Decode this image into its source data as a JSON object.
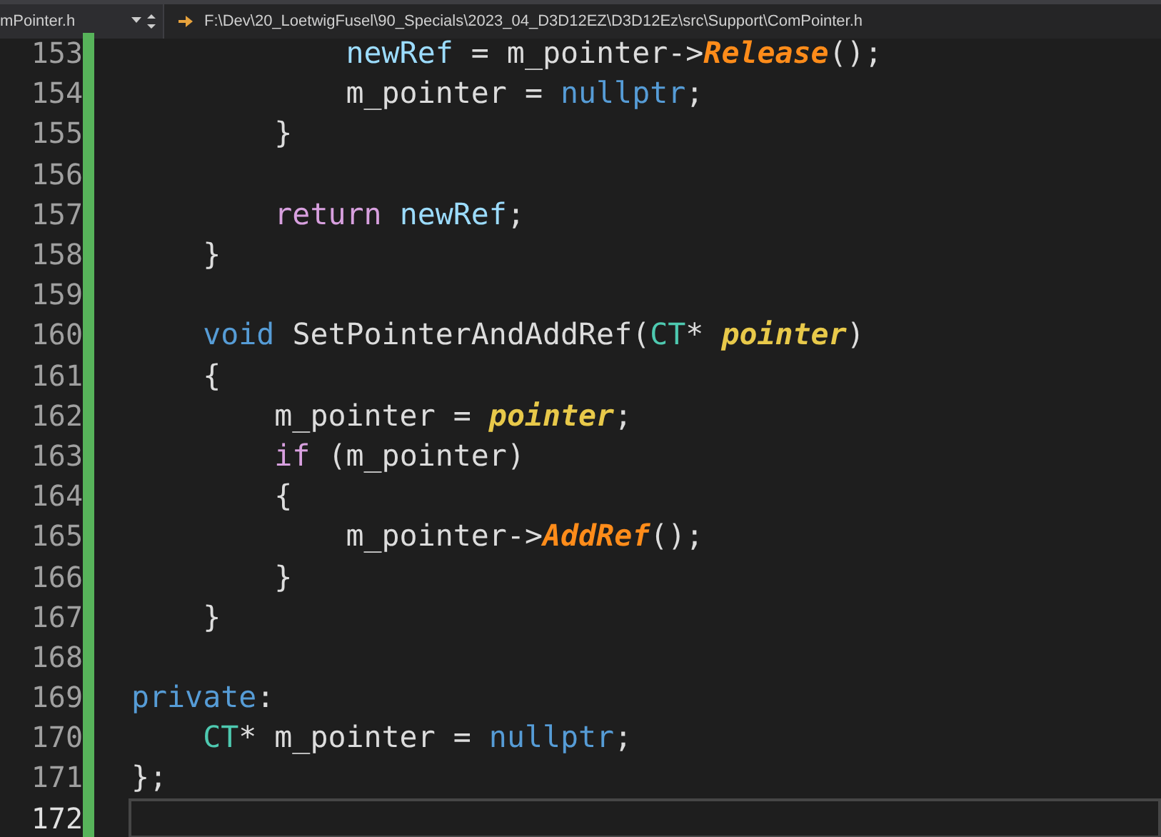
{
  "navigation_bar": {
    "file_dropdown": "mPointer.h",
    "path": "F:\\Dev\\20_LoetwigFusel\\90_Specials\\2023_04_D3D12EZ\\D3D12Ez\\src\\Support\\ComPointer.h"
  },
  "editor": {
    "lines": [
      {
        "number": "153",
        "current": false,
        "tokens": [
          {
            "text": "            newRef",
            "kind": "variable"
          },
          {
            "text": " = m_pointer->",
            "kind": "plain"
          },
          {
            "text": "Release",
            "kind": "method"
          },
          {
            "text": "();",
            "kind": "plain"
          }
        ]
      },
      {
        "number": "154",
        "current": false,
        "tokens": [
          {
            "text": "            m_pointer = ",
            "kind": "plain"
          },
          {
            "text": "nullptr",
            "kind": "keyword"
          },
          {
            "text": ";",
            "kind": "plain"
          }
        ]
      },
      {
        "number": "155",
        "current": false,
        "tokens": [
          {
            "text": "        }",
            "kind": "plain"
          }
        ]
      },
      {
        "number": "156",
        "current": false
      },
      {
        "number": "157",
        "current": false,
        "tokens": [
          {
            "text": "        return",
            "kind": "control"
          },
          {
            "text": " newRef",
            "kind": "variable"
          },
          {
            "text": ";",
            "kind": "plain"
          }
        ]
      },
      {
        "number": "158",
        "current": false,
        "tokens": [
          {
            "text": "    }",
            "kind": "plain"
          }
        ]
      },
      {
        "number": "159",
        "current": false
      },
      {
        "number": "160",
        "current": false,
        "tokens": [
          {
            "text": "    void",
            "kind": "keyword"
          },
          {
            "text": " SetPointerAndAddRef(",
            "kind": "plain"
          },
          {
            "text": "CT",
            "kind": "type"
          },
          {
            "text": "* ",
            "kind": "plain"
          },
          {
            "text": "pointer",
            "kind": "parameter"
          },
          {
            "text": ")",
            "kind": "plain"
          }
        ]
      },
      {
        "number": "161",
        "current": false,
        "tokens": [
          {
            "text": "    {",
            "kind": "plain"
          }
        ]
      },
      {
        "number": "162",
        "current": false,
        "tokens": [
          {
            "text": "        m_pointer = ",
            "kind": "plain"
          },
          {
            "text": "pointer",
            "kind": "parameter"
          },
          {
            "text": ";",
            "kind": "plain"
          }
        ]
      },
      {
        "number": "163",
        "current": false,
        "tokens": [
          {
            "text": "        if",
            "kind": "control"
          },
          {
            "text": " (m_pointer)",
            "kind": "plain"
          }
        ]
      },
      {
        "number": "164",
        "current": false,
        "tokens": [
          {
            "text": "        {",
            "kind": "plain"
          }
        ]
      },
      {
        "number": "165",
        "current": false,
        "tokens": [
          {
            "text": "            m_pointer->",
            "kind": "plain"
          },
          {
            "text": "AddRef",
            "kind": "method"
          },
          {
            "text": "();",
            "kind": "plain"
          }
        ]
      },
      {
        "number": "166",
        "current": false,
        "tokens": [
          {
            "text": "        }",
            "kind": "plain"
          }
        ]
      },
      {
        "number": "167",
        "current": false,
        "tokens": [
          {
            "text": "    }",
            "kind": "plain"
          }
        ]
      },
      {
        "number": "168",
        "current": false
      },
      {
        "number": "169",
        "current": false,
        "tokens": [
          {
            "text": "private",
            "kind": "keyword"
          },
          {
            "text": ":",
            "kind": "plain"
          }
        ]
      },
      {
        "number": "170",
        "current": false,
        "tokens": [
          {
            "text": "    CT",
            "kind": "type"
          },
          {
            "text": "* m_pointer = ",
            "kind": "plain"
          },
          {
            "text": "nullptr",
            "kind": "keyword"
          },
          {
            "text": ";",
            "kind": "plain"
          }
        ]
      },
      {
        "number": "171",
        "current": false,
        "tokens": [
          {
            "text": "};",
            "kind": "plain"
          }
        ]
      },
      {
        "number": "172",
        "current": true
      }
    ]
  }
}
